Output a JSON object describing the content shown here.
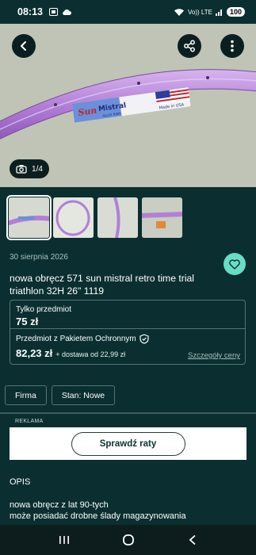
{
  "status_bar": {
    "time": "08:13",
    "network": "Vo)) LTE",
    "battery": "100"
  },
  "hero": {
    "image_counter": "1/4",
    "decal_brand": "Sun",
    "decal_model": "Mistral",
    "decal_sub": "ALLOY RIMS",
    "decal_origin": "Made in USA"
  },
  "listing": {
    "date": "30 sierpnia 2026",
    "title_line1": "nowa obręcz 571 sun mistral retro time trial",
    "title_line2": "triathlon 32H 26\" 1119",
    "item_only_label": "Tylko przedmiot",
    "item_only_price": "75 zł",
    "protection_label": "Przedmiot z Pakietem Ochronnym",
    "protection_price": "82,23 zł",
    "delivery": "+ dostawa od 22,99 zł",
    "details_link": "Szczegóły ceny"
  },
  "attributes": [
    {
      "label": "Firma"
    },
    {
      "label": "Stan: Nowe"
    }
  ],
  "ad": {
    "label": "REKLAMA",
    "button": "Sprawdź raty"
  },
  "description": {
    "heading": "OPIS",
    "line1": "nowa obręcz z lat 90-tych",
    "line2": "może posiadać drobne ślady magazynowania",
    "line3": "..."
  },
  "colors": {
    "background": "#0b2f30",
    "accent": "#69dcc7",
    "rim": "#b27fd6"
  }
}
